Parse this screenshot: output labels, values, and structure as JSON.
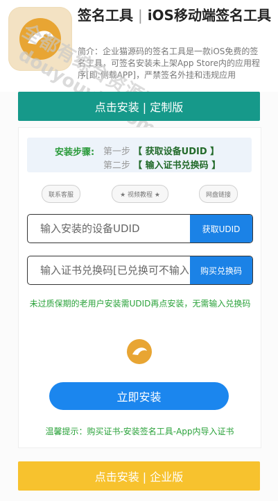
{
  "header": {
    "title_part1": "签名工具",
    "title_separator": "|",
    "title_part2": "iOS移动端签名工具",
    "description": "简介：企业猫源码的签名工具是一款iOS免费的签名工具，可签名安装未上架App Store内的应用程序[即:侧载APP]，严禁签名外挂和违规应用",
    "logo_icon": "app-logo-icon"
  },
  "watermark": {
    "line1": "全都有综合资源网",
    "line2": "douyouvip.com"
  },
  "top_button": {
    "label": "点击安装 | 定制版"
  },
  "steps": {
    "label": "安装步骤:",
    "step1_prefix": "第一步",
    "step1_action": "【 获取设备UDID 】",
    "step2_prefix": "第二步",
    "step2_action": "【 输入证书兑换码 】"
  },
  "pills": {
    "contact": "联系客服",
    "video": "★ 视频教程 ★",
    "cloud": "网盘链接"
  },
  "udid": {
    "placeholder": "输入安装的设备UDID",
    "button": "获取UDID"
  },
  "code": {
    "placeholder": "输入证书兑换码[已兑换可不输入]",
    "button": "购买兑换码"
  },
  "notice": "未过质保期的老用户安装需UDID再点安装，无需输入兑换码",
  "install_button": "立即安装",
  "tip": "温馨提示：购买证书-安装签名工具-App内导入证书",
  "bottom_button": {
    "label": "点击安装 | 企业版"
  },
  "colors": {
    "teal": "#16998a",
    "blue": "#1b86ee",
    "yellow": "#f7c22e",
    "green_text": "#2aa23a"
  }
}
